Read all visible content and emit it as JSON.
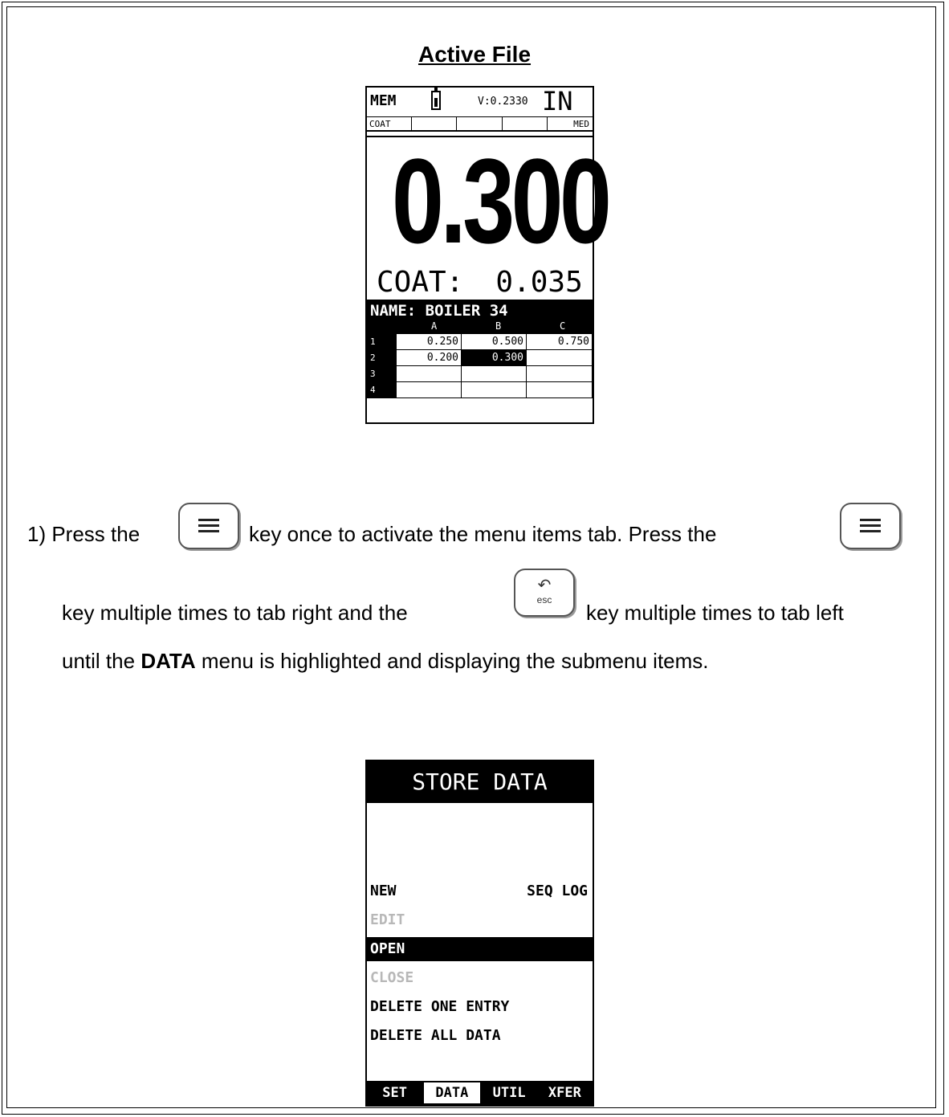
{
  "section_title": "Active File",
  "screen1": {
    "mem": "MEM",
    "velocity": "V:0.2330",
    "unit": "IN",
    "status_cells": [
      "COAT",
      "",
      "",
      "",
      "MED"
    ],
    "reading": "0.300",
    "coat_label": "COAT:",
    "coat_value": "0.035",
    "name": "NAME: BOILER 34",
    "columns": [
      "A",
      "B",
      "C"
    ],
    "rows": [
      {
        "n": "1",
        "cells": [
          "0.250",
          "0.500",
          "0.750"
        ]
      },
      {
        "n": "2",
        "cells": [
          "0.200",
          "0.300",
          ""
        ]
      },
      {
        "n": "3",
        "cells": [
          "",
          "",
          ""
        ]
      },
      {
        "n": "4",
        "cells": [
          "",
          "",
          ""
        ]
      }
    ]
  },
  "instructions": {
    "line1_a": "1)  Press the",
    "line1_b": "key once to activate the menu items tab.  Press the",
    "line2_a": "key multiple times to tab right and the",
    "line2_b": "key multiple times to tab left",
    "line3_a": "until the",
    "line3_bold": "DATA",
    "line3_b": "menu is highlighted and displaying the submenu items.",
    "esc_label": "esc"
  },
  "screen2": {
    "title": "STORE DATA",
    "items": [
      {
        "label": "NEW",
        "right": "SEQ LOG",
        "state": "normal"
      },
      {
        "label": "EDIT",
        "right": "",
        "state": "disabled"
      },
      {
        "label": "OPEN",
        "right": "",
        "state": "highlighted"
      },
      {
        "label": "CLOSE",
        "right": "",
        "state": "disabled"
      },
      {
        "label": "DELETE ONE ENTRY",
        "right": "",
        "state": "normal"
      },
      {
        "label": "DELETE ALL DATA",
        "right": "",
        "state": "normal"
      }
    ],
    "tabs": [
      "SET",
      "DATA",
      "UTIL",
      "XFER"
    ],
    "active_tab": "DATA"
  }
}
